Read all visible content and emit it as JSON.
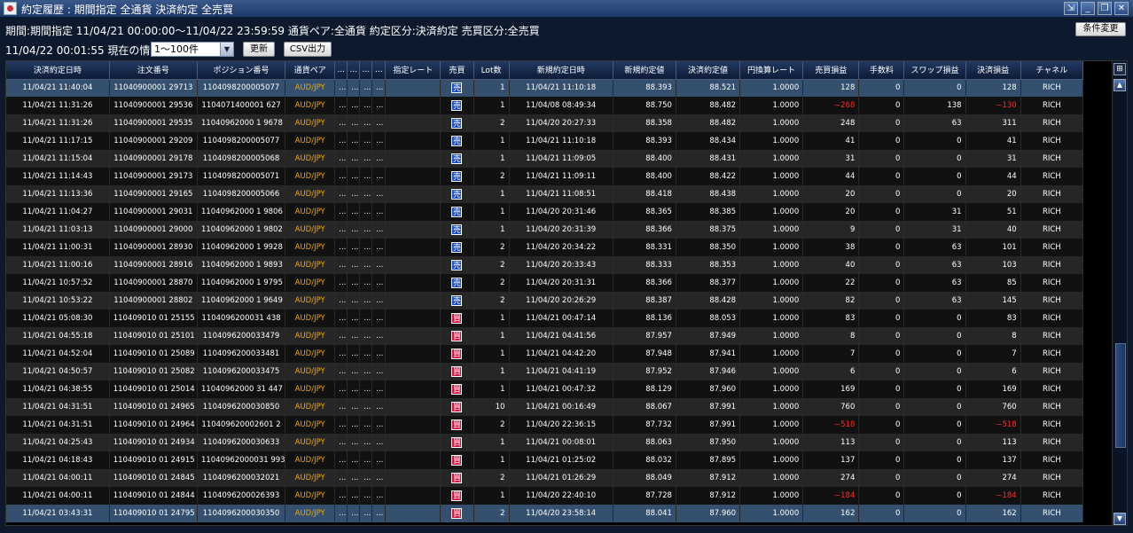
{
  "window": {
    "title": "約定履歴 : 期間指定 全通貨 決済約定 全売買",
    "controls": [
      "⇲",
      "_",
      "❐",
      "✕"
    ]
  },
  "info": {
    "line1": "期間:期間指定  11/04/21 00:00:00〜11/04/22 23:59:59  通貨ペア:全通貨  約定区分:決済約定  売買区分:全売買",
    "line2": "11/04/22 00:01:55 現在の情報"
  },
  "buttons": {
    "change_conditions": "条件変更",
    "range_select_value": "1〜100件",
    "update": "更新",
    "csv": "CSV出力"
  },
  "colors": {
    "sell_badge": "#1448c8",
    "buy_badge": "#d4103c",
    "currency_pair": "#f2a600",
    "negative": "#ff2b2b",
    "selected_row": "#34506e"
  },
  "table": {
    "columns": [
      "決済約定日時",
      "注文番号",
      "ポジション番号",
      "通貨ペア",
      "...",
      "...",
      "...",
      "...",
      "指定レート",
      "売買",
      "Lot数",
      "新規約定日時",
      "新規約定値",
      "決済約定値",
      "円換算レート",
      "売買損益",
      "手数料",
      "スワップ損益",
      "決済損益",
      "チャネル"
    ],
    "rows": [
      [
        "11/04/21 11:40:04",
        "11040900001 29713",
        "1104098200005077",
        "AUD/JPY",
        "...",
        "...",
        "...",
        "...",
        "",
        "売",
        "1",
        "11/04/21 11:10:18",
        "88.393",
        "88.521",
        "1.0000",
        "128",
        "0",
        "0",
        "128",
        "RICH"
      ],
      [
        "11/04/21 11:31:26",
        "11040900001 29536",
        "1104071400001 627",
        "AUD/JPY",
        "...",
        "...",
        "...",
        "...",
        "",
        "売",
        "1",
        "11/04/08 08:49:34",
        "88.750",
        "88.482",
        "1.0000",
        "−268",
        "0",
        "138",
        "−130",
        "RICH"
      ],
      [
        "11/04/21 11:31:26",
        "11040900001 29535",
        "11040962000 1 9678",
        "AUD/JPY",
        "...",
        "...",
        "...",
        "...",
        "",
        "売",
        "2",
        "11/04/20 20:27:33",
        "88.358",
        "88.482",
        "1.0000",
        "248",
        "0",
        "63",
        "311",
        "RICH"
      ],
      [
        "11/04/21 11:17:15",
        "11040900001 29209",
        "1104098200005077",
        "AUD/JPY",
        "...",
        "...",
        "...",
        "...",
        "",
        "売",
        "1",
        "11/04/21 11:10:18",
        "88.393",
        "88.434",
        "1.0000",
        "41",
        "0",
        "0",
        "41",
        "RICH"
      ],
      [
        "11/04/21 11:15:04",
        "11040900001 29178",
        "1104098200005068",
        "AUD/JPY",
        "...",
        "...",
        "...",
        "...",
        "",
        "売",
        "1",
        "11/04/21 11:09:05",
        "88.400",
        "88.431",
        "1.0000",
        "31",
        "0",
        "0",
        "31",
        "RICH"
      ],
      [
        "11/04/21 11:14:43",
        "11040900001 29173",
        "1104098200005071",
        "AUD/JPY",
        "...",
        "...",
        "...",
        "...",
        "",
        "売",
        "2",
        "11/04/21 11:09:11",
        "88.400",
        "88.422",
        "1.0000",
        "44",
        "0",
        "0",
        "44",
        "RICH"
      ],
      [
        "11/04/21 11:13:36",
        "11040900001 29165",
        "1104098200005066",
        "AUD/JPY",
        "...",
        "...",
        "...",
        "...",
        "",
        "売",
        "1",
        "11/04/21 11:08:51",
        "88.418",
        "88.438",
        "1.0000",
        "20",
        "0",
        "0",
        "20",
        "RICH"
      ],
      [
        "11/04/21 11:04:27",
        "11040900001 29031",
        "11040962000 1 9806",
        "AUD/JPY",
        "...",
        "...",
        "...",
        "...",
        "",
        "売",
        "1",
        "11/04/20 20:31:46",
        "88.365",
        "88.385",
        "1.0000",
        "20",
        "0",
        "31",
        "51",
        "RICH"
      ],
      [
        "11/04/21 11:03:13",
        "11040900001 29000",
        "11040962000 1 9802",
        "AUD/JPY",
        "...",
        "...",
        "...",
        "...",
        "",
        "売",
        "1",
        "11/04/20 20:31:39",
        "88.366",
        "88.375",
        "1.0000",
        "9",
        "0",
        "31",
        "40",
        "RICH"
      ],
      [
        "11/04/21 11:00:31",
        "11040900001 28930",
        "11040962000 1 9928",
        "AUD/JPY",
        "...",
        "...",
        "...",
        "...",
        "",
        "売",
        "2",
        "11/04/20 20:34:22",
        "88.331",
        "88.350",
        "1.0000",
        "38",
        "0",
        "63",
        "101",
        "RICH"
      ],
      [
        "11/04/21 11:00:16",
        "11040900001 28916",
        "11040962000 1 9893",
        "AUD/JPY",
        "...",
        "...",
        "...",
        "...",
        "",
        "売",
        "2",
        "11/04/20 20:33:43",
        "88.333",
        "88.353",
        "1.0000",
        "40",
        "0",
        "63",
        "103",
        "RICH"
      ],
      [
        "11/04/21 10:57:52",
        "11040900001 28870",
        "11040962000 1 9795",
        "AUD/JPY",
        "...",
        "...",
        "...",
        "...",
        "",
        "売",
        "2",
        "11/04/20 20:31:31",
        "88.366",
        "88.377",
        "1.0000",
        "22",
        "0",
        "63",
        "85",
        "RICH"
      ],
      [
        "11/04/21 10:53:22",
        "11040900001 28802",
        "11040962000 1 9649",
        "AUD/JPY",
        "...",
        "...",
        "...",
        "...",
        "",
        "売",
        "2",
        "11/04/20 20:26:29",
        "88.387",
        "88.428",
        "1.0000",
        "82",
        "0",
        "63",
        "145",
        "RICH"
      ],
      [
        "11/04/21 05:08:30",
        "110409010 01 25155",
        "1104096200031 438",
        "AUD/JPY",
        "...",
        "...",
        "...",
        "...",
        "",
        "買",
        "1",
        "11/04/21 00:47:14",
        "88.136",
        "88.053",
        "1.0000",
        "83",
        "0",
        "0",
        "83",
        "RICH"
      ],
      [
        "11/04/21 04:55:18",
        "110409010 01 25101",
        "1104096200033479",
        "AUD/JPY",
        "...",
        "...",
        "...",
        "...",
        "",
        "買",
        "1",
        "11/04/21 04:41:56",
        "87.957",
        "87.949",
        "1.0000",
        "8",
        "0",
        "0",
        "8",
        "RICH"
      ],
      [
        "11/04/21 04:52:04",
        "110409010 01 25089",
        "1104096200033481",
        "AUD/JPY",
        "...",
        "...",
        "...",
        "...",
        "",
        "買",
        "1",
        "11/04/21 04:42:20",
        "87.948",
        "87.941",
        "1.0000",
        "7",
        "0",
        "0",
        "7",
        "RICH"
      ],
      [
        "11/04/21 04:50:57",
        "110409010 01 25082",
        "1104096200033475",
        "AUD/JPY",
        "...",
        "...",
        "...",
        "...",
        "",
        "買",
        "1",
        "11/04/21 04:41:19",
        "87.952",
        "87.946",
        "1.0000",
        "6",
        "0",
        "0",
        "6",
        "RICH"
      ],
      [
        "11/04/21 04:38:55",
        "110409010 01 25014",
        "11040962000 31 447",
        "AUD/JPY",
        "...",
        "...",
        "...",
        "...",
        "",
        "買",
        "1",
        "11/04/21 00:47:32",
        "88.129",
        "87.960",
        "1.0000",
        "169",
        "0",
        "0",
        "169",
        "RICH"
      ],
      [
        "11/04/21 04:31:51",
        "110409010 01 24965",
        "1104096200030850",
        "AUD/JPY",
        "...",
        "...",
        "...",
        "...",
        "",
        "買",
        "10",
        "11/04/21 00:16:49",
        "88.067",
        "87.991",
        "1.0000",
        "760",
        "0",
        "0",
        "760",
        "RICH"
      ],
      [
        "11/04/21 04:31:51",
        "110409010 01 24964",
        "110409620002601 2",
        "AUD/JPY",
        "...",
        "...",
        "...",
        "...",
        "",
        "買",
        "2",
        "11/04/20 22:36:15",
        "87.732",
        "87.991",
        "1.0000",
        "−518",
        "0",
        "0",
        "−518",
        "RICH"
      ],
      [
        "11/04/21 04:25:43",
        "110409010 01 24934",
        "1104096200030633",
        "AUD/JPY",
        "...",
        "...",
        "...",
        "...",
        "",
        "買",
        "1",
        "11/04/21 00:08:01",
        "88.063",
        "87.950",
        "1.0000",
        "113",
        "0",
        "0",
        "113",
        "RICH"
      ],
      [
        "11/04/21 04:18:43",
        "110409010 01 24915",
        "11040962000031 993",
        "AUD/JPY",
        "...",
        "...",
        "...",
        "...",
        "",
        "買",
        "1",
        "11/04/21 01:25:02",
        "88.032",
        "87.895",
        "1.0000",
        "137",
        "0",
        "0",
        "137",
        "RICH"
      ],
      [
        "11/04/21 04:00:11",
        "110409010 01 24845",
        "1104096200032021",
        "AUD/JPY",
        "...",
        "...",
        "...",
        "...",
        "",
        "買",
        "2",
        "11/04/21 01:26:29",
        "88.049",
        "87.912",
        "1.0000",
        "274",
        "0",
        "0",
        "274",
        "RICH"
      ],
      [
        "11/04/21 04:00:11",
        "110409010 01 24844",
        "1104096200026393",
        "AUD/JPY",
        "...",
        "...",
        "...",
        "...",
        "",
        "買",
        "1",
        "11/04/20 22:40:10",
        "87.728",
        "87.912",
        "1.0000",
        "−184",
        "0",
        "0",
        "−184",
        "RICH"
      ],
      [
        "11/04/21 03:43:31",
        "110409010 01 24795",
        "1104096200030350",
        "AUD/JPY",
        "...",
        "...",
        "...",
        "...",
        "",
        "買",
        "2",
        "11/04/20 23:58:14",
        "88.041",
        "87.960",
        "1.0000",
        "162",
        "0",
        "0",
        "162",
        "RICH"
      ]
    ]
  },
  "scrollbar": {
    "config_icon": "settings-icon",
    "up": "▲",
    "down": "▼",
    "position_fraction": 0.8,
    "visible_fraction": 0.25
  }
}
